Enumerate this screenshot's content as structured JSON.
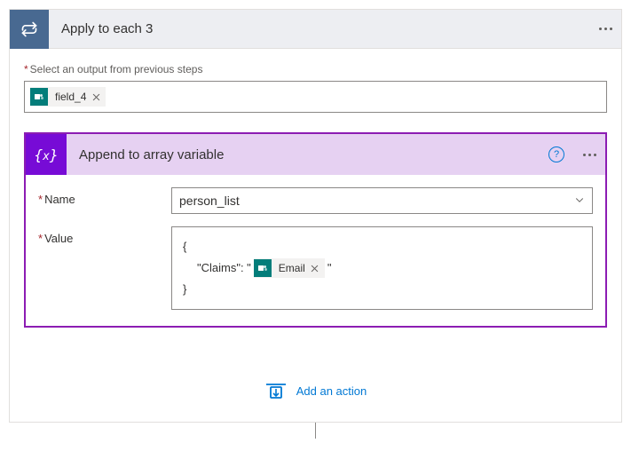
{
  "outer": {
    "title": "Apply to each 3",
    "output_label": "Select an output from previous steps",
    "output_token": "field_4"
  },
  "inner": {
    "title": "Append to array variable",
    "name_label": "Name",
    "name_value": "person_list",
    "value_label": "Value",
    "value_line1": "{",
    "value_line2_prefix": "\"Claims\": \"",
    "value_token": "Email",
    "value_line2_suffix": "\"",
    "value_line3": "}"
  },
  "footer": {
    "add_action": "Add an action"
  }
}
